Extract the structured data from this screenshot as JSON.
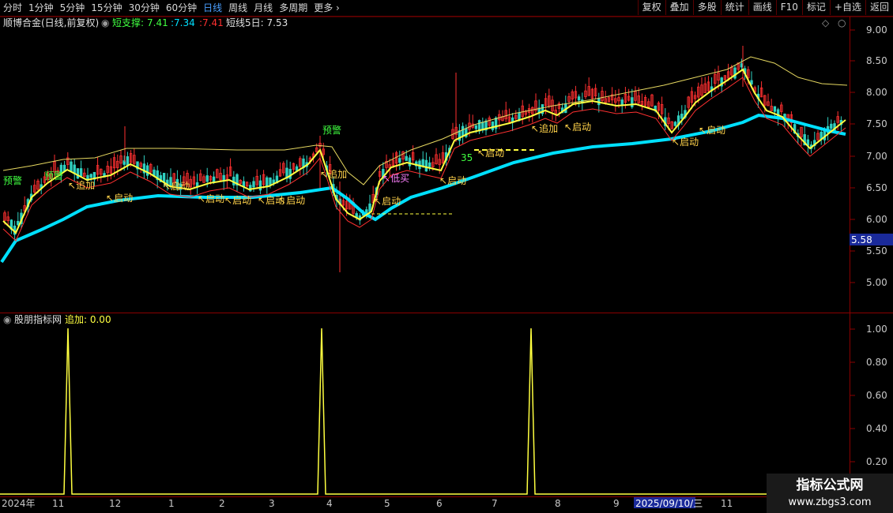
{
  "toolbar": {
    "periods": [
      "分时",
      "1分钟",
      "5分钟",
      "15分钟",
      "30分钟",
      "60分钟",
      "日线",
      "周线",
      "月线",
      "多周期",
      "更多"
    ],
    "active_period": "日线",
    "more_arrow": "›",
    "buttons": [
      "复权",
      "叠加",
      "多股",
      "统计",
      "画线",
      "F10",
      "标记",
      "+自选",
      "返回"
    ]
  },
  "main_pane": {
    "title": "顺博合金(日线,前复权)",
    "indicator_name": "短支撑:",
    "value1": "7.41",
    "value2": ":7.34",
    "value3": ":7.41",
    "ma5_label": "短线5日: 7.53",
    "price_tag": "5.58",
    "y_ticks": [
      "9.00",
      "8.50",
      "8.00",
      "7.50",
      "7.00",
      "6.50",
      "6.00",
      "5.50",
      "5.00"
    ]
  },
  "sub_pane": {
    "title": "股朋指标网",
    "indicator": "追加: 0.00",
    "y_ticks": [
      "1.00",
      "0.80",
      "0.60",
      "0.40",
      "0.20"
    ]
  },
  "annotations": {
    "warning": "预警",
    "add": "追加",
    "start": "启动",
    "low_buy": "低买",
    "count_35": "35",
    "arrow": "↖"
  },
  "date_axis": {
    "labels": [
      "2024年",
      "11",
      "12",
      "1",
      "2",
      "3",
      "4",
      "5",
      "6",
      "7",
      "8",
      "9",
      "11"
    ],
    "cursor_date": "2025/09/10/三"
  },
  "watermark": {
    "line1": "指标公式网",
    "line2": "www.zbgs3.com"
  },
  "colors": {
    "support": "#00e0ff",
    "mid": "#ffff40",
    "upper": "#e6d860",
    "up_candle": "#ff3030",
    "down_candle": "#30d0c0",
    "grid": "#8b0000",
    "warn": "#40ff40",
    "start": "#ffd24a",
    "low_buy": "#ff80ff"
  }
}
